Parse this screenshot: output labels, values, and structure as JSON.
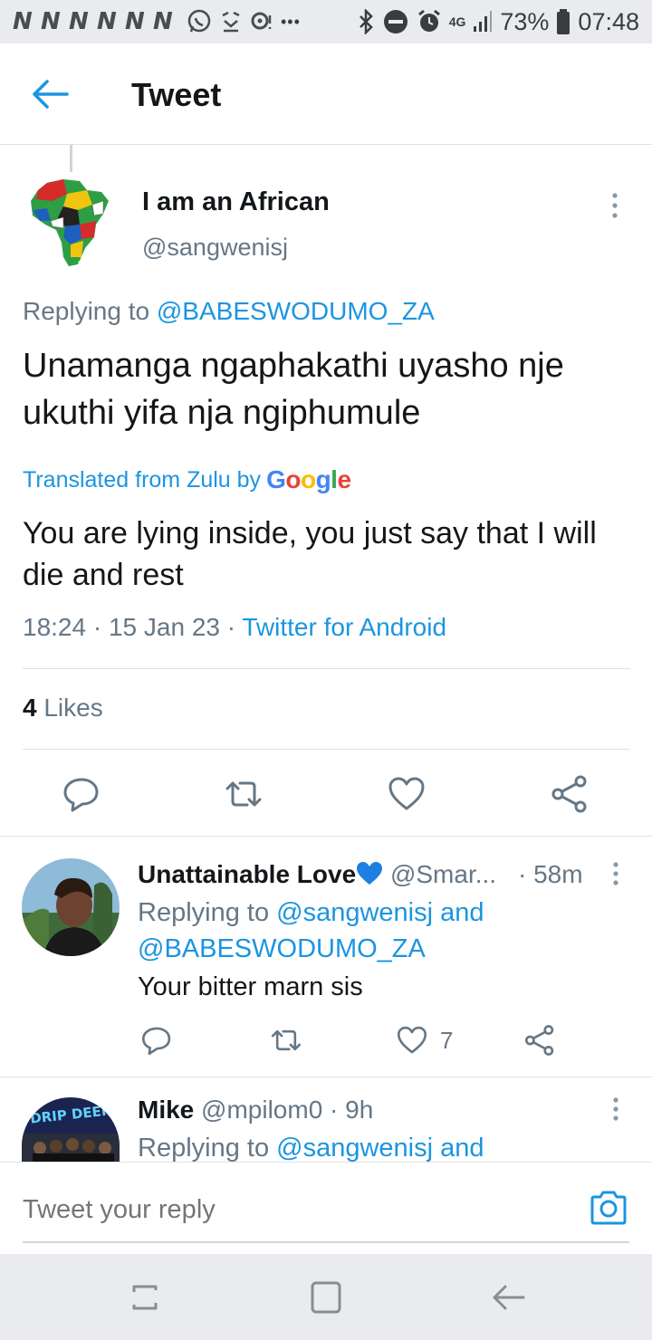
{
  "status_bar": {
    "left_letters": [
      "N",
      "N",
      "N",
      "N",
      "N",
      "N"
    ],
    "dots": "•••",
    "network": "4G",
    "battery": "73%",
    "time": "07:48"
  },
  "header": {
    "title": "Tweet"
  },
  "main_tweet": {
    "author_name": "I am an African",
    "author_handle": "@sangwenisj",
    "replying_prefix": "Replying to",
    "replying_to": "@BABESWODUMO_ZA",
    "text": "Unamanga ngaphakathi uyasho nje ukuthi yifa nja ngiphumule",
    "translated_label": "Translated from Zulu by",
    "google_letters": [
      "G",
      "o",
      "o",
      "g",
      "l",
      "e"
    ],
    "google_colors": [
      "#4285f4",
      "#ea4335",
      "#fbbc05",
      "#4285f4",
      "#34a853",
      "#ea4335"
    ],
    "translation": "You are lying inside, you just say that I will die and rest",
    "time": "18:24",
    "date": "15 Jan 23",
    "client": "Twitter for Android",
    "separator": "·",
    "likes_count": "4",
    "likes_label": "Likes"
  },
  "replies": [
    {
      "name": "Unattainable Love",
      "heart_emoji": "blue-heart",
      "handle": "@Smar...",
      "time": "· 58m",
      "replying_prefix": "Replying to",
      "replying_to_1": "@sangwenisj",
      "replying_and": "and",
      "replying_to_2": "@BABESWODUMO_ZA",
      "text": "Your bitter marn sis",
      "like_count": "7"
    },
    {
      "name": "Mike",
      "handle": "@mpilom0",
      "time": "· 9h",
      "replying_prefix": "Replying to",
      "replying_to_1": "@sangwenisj",
      "replying_and": "and",
      "avatar_text": "DRIP DEEP"
    }
  ],
  "compose": {
    "placeholder": "Tweet your reply"
  },
  "colors": {
    "accent": "#1b95e0",
    "muted": "#657786",
    "text": "#14171a",
    "divider": "#dfe3e6",
    "heart_blue": "#1d7fe0"
  }
}
